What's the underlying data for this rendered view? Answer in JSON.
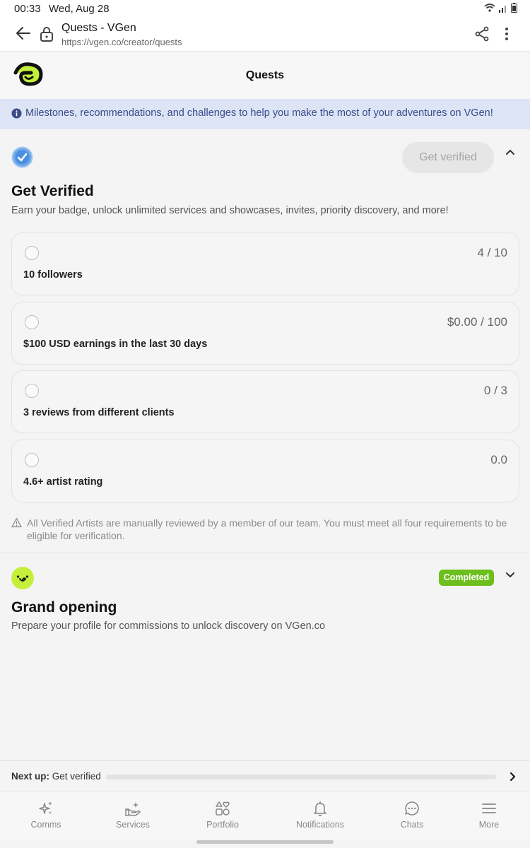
{
  "status_bar": {
    "time": "00:33",
    "date": "Wed, Aug 28"
  },
  "browser": {
    "title": "Quests - VGen",
    "url": "https://vgen.co/creator/quests"
  },
  "header": {
    "title": "Quests"
  },
  "banner": {
    "text": "Milestones, recommendations, and challenges to help you make the most of your adventures on VGen!"
  },
  "verified_section": {
    "button_label": "Get verified",
    "title": "Get Verified",
    "description": "Earn your badge, unlock unlimited services and showcases, invites, priority discovery, and more!",
    "requirements": [
      {
        "label": "10 followers",
        "value": "4 / 10"
      },
      {
        "label": "$100 USD earnings in the last 30 days",
        "value": "$0.00 / 100"
      },
      {
        "label": "3 reviews from different clients",
        "value": "0 / 3"
      },
      {
        "label": "4.6+ artist rating",
        "value": "0.0"
      }
    ],
    "note": "All Verified Artists are manually reviewed by a member of our team. You must meet all four requirements to be eligible for verification."
  },
  "grand_opening": {
    "badge": "Completed",
    "title": "Grand opening",
    "description": "Prepare your profile for commissions to unlock discovery on VGen.co"
  },
  "next_up": {
    "label": "Next up:",
    "value": "Get verified",
    "progress": 0
  },
  "bottom_nav": [
    {
      "label": "Comms",
      "icon": "sparkles-icon"
    },
    {
      "label": "Services",
      "icon": "hand-sparkle-icon"
    },
    {
      "label": "Portfolio",
      "icon": "shapes-icon"
    },
    {
      "label": "Notifications",
      "icon": "bell-icon"
    },
    {
      "label": "Chats",
      "icon": "chat-icon"
    },
    {
      "label": "More",
      "icon": "menu-icon"
    }
  ],
  "colors": {
    "brand_green": "#c4f03c",
    "badge_green": "#6cbf1d",
    "banner_bg": "#dde4f5",
    "banner_text": "#3a4a8a"
  }
}
